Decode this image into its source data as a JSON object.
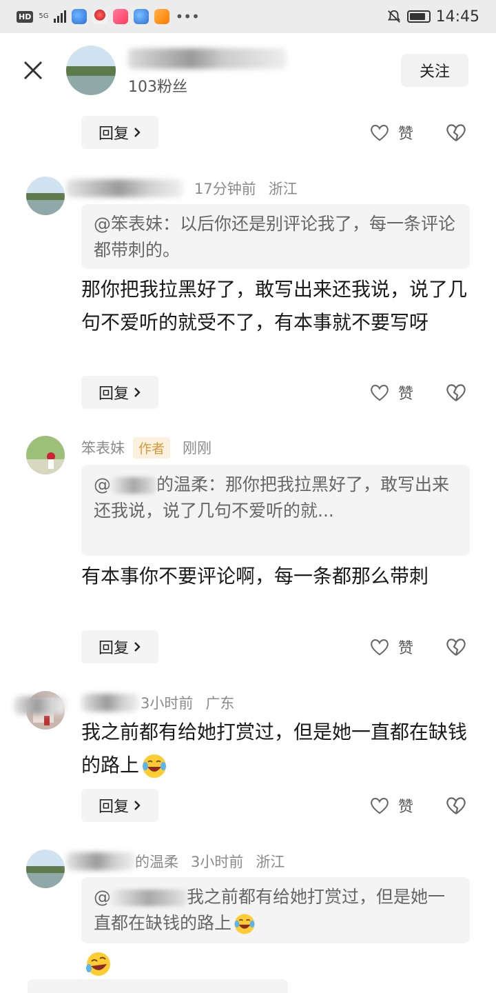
{
  "status_bar": {
    "left_badge": "HD",
    "signal_label": "5G",
    "time": "14:45"
  },
  "header": {
    "fans": "103粉丝",
    "follow_label": "关注"
  },
  "ui": {
    "reply_label": "回复",
    "like_label": "赞"
  },
  "comments": [
    {
      "time": "17分钟前",
      "location": "浙江",
      "quote": "@笨表妹：以后你还是别评论我了，每一条评论都带刺的。",
      "text": "那你把我拉黑好了，敢写出来还我说，说了几句不爱听的就受不了，有本事就不要写呀"
    },
    {
      "name": "笨表妹",
      "tag": "作者",
      "time": "刚刚",
      "quote_prefix": "@",
      "quote_rest": "的温柔：那你把我拉黑好了，敢写出来还我说，说了几句不爱听的就...",
      "text": "有本事你不要评论啊，每一条都那么带刺"
    },
    {
      "time": "3小时前",
      "location": "广东",
      "text": "我之前都有给她打赏过，但是她一直都在缺钱的路上"
    },
    {
      "name_suffix": "的温柔",
      "time": "3小时前",
      "location": "浙江",
      "quote_prefix": "@",
      "quote_rest": "我之前都有给她打赏过，但是她一直都在缺钱的路上"
    }
  ],
  "icons": {
    "close": "close-icon",
    "like": "heart-outline-icon",
    "dislike": "broken-heart-icon",
    "chevron": "chevron-right-icon",
    "emoji": "tears-of-joy-emoji"
  },
  "colors": {
    "author_tag": "#d69a3a",
    "quote_bg": "#f4f4f4",
    "meta_text": "#8a8a8a"
  }
}
